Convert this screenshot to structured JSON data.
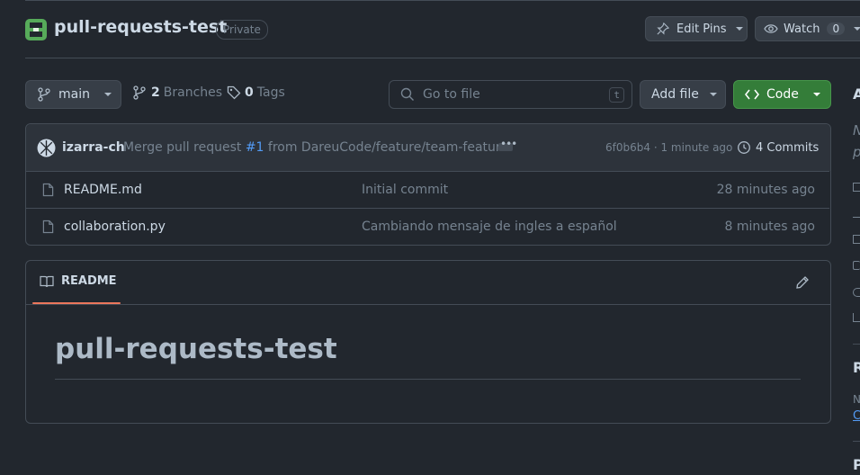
{
  "repo": {
    "name": "pull-requests-test",
    "visibility": "Private"
  },
  "header_actions": {
    "edit_pins_label": "Edit Pins",
    "watch_label": "Watch",
    "watch_count": "0"
  },
  "toolbar": {
    "branch": "main",
    "branches_count": "2",
    "branches_label": "Branches",
    "tags_count": "0",
    "tags_label": "Tags",
    "search_placeholder": "Go to file",
    "search_shortcut": "t",
    "add_file_label": "Add file",
    "code_label": "Code"
  },
  "latest_commit": {
    "author": "izarra-ch",
    "message_prefix": "Merge pull request",
    "pr_number": "#1",
    "message_suffix": "from DareuCode/feature/team-feature",
    "sha": "6f0b6b4",
    "separator": "·",
    "time": "1 minute ago",
    "commits_label": "4 Commits"
  },
  "files": [
    {
      "name": "README.md",
      "message": "Initial commit",
      "time": "28 minutes ago"
    },
    {
      "name": "collaboration.py",
      "message": "Cambiando mensaje de ingles a español",
      "time": "8 minutes ago"
    }
  ],
  "readme": {
    "tab_label": "README",
    "heading": "pull-requests-test"
  },
  "sidebar_partial": {
    "about_letter": "A",
    "desc_line1": "N",
    "desc_line2": "p",
    "releases_letter": "R",
    "releases_sub": "N",
    "releases_link": "C",
    "packages_letter": "P"
  },
  "colors": {
    "background": "#22272e",
    "border": "#444c56",
    "code_button": "#347d39",
    "link": "#539bf5",
    "tab_underline": "#ec775c"
  }
}
